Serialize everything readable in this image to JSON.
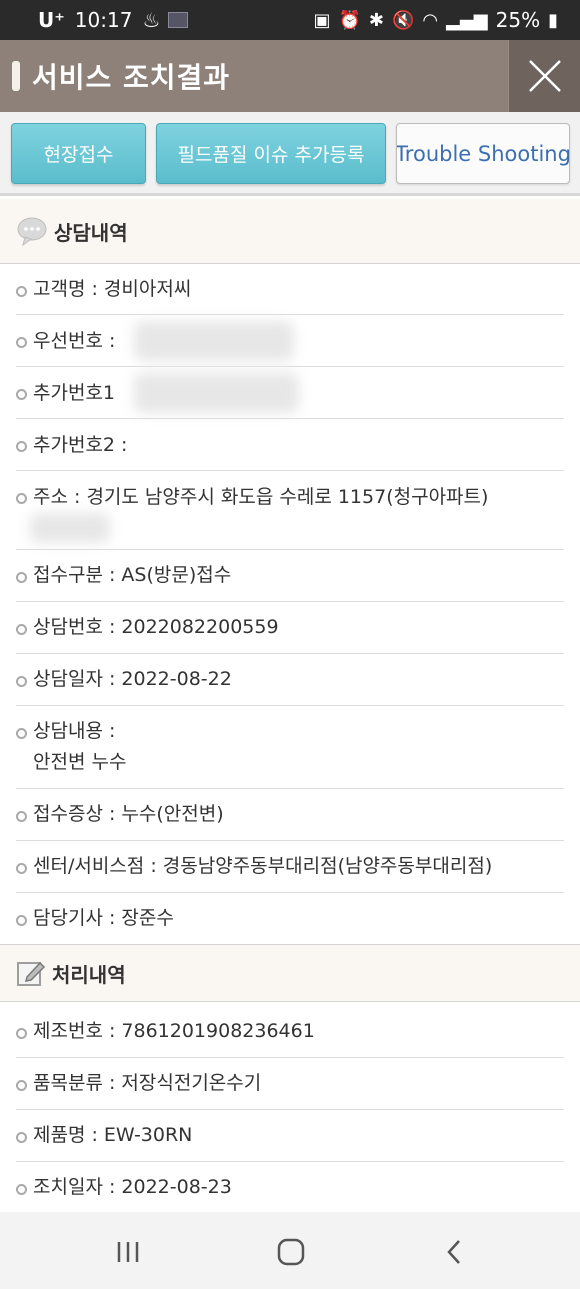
{
  "status_bar": {
    "carrier": "U⁺",
    "time": "10:17",
    "battery": "25%"
  },
  "title_bar": {
    "title": "서비스 조치결과"
  },
  "buttons": {
    "onsite": "현장접수",
    "field_quality": "필드품질 이슈 추가등록",
    "trouble": "Trouble Shooting"
  },
  "consultation": {
    "header": "상담내역",
    "customer": "고객명 : 경비아저씨",
    "phone_label": "우선번호 :",
    "extra1_label": "추가번호1",
    "extra2_label": "추가번호2 :",
    "address": "주소 : 경기도 남양주시 화도읍 수레로 1157(청구아파트)",
    "reception_type": "접수구분 : AS(방문)접수",
    "consult_no": "상담번호 : 2022082200559",
    "consult_date": "상담일자 : 2022-08-22",
    "content_label": "상담내용 :",
    "content_value": "안전변 누수",
    "symptom": "접수증상 : 누수(안전변)",
    "center": "센터/서비스점 : 경동남양주동부대리점(남양주동부대리점)",
    "engineer": "담당기사 : 장준수"
  },
  "processing": {
    "header": "처리내역",
    "serial": "제조번호 : 7861201908236461",
    "category": "품목분류 : 저장식전기온수기",
    "model": "제품명 : EW-30RN",
    "action_date": "조치일자 : 2022-08-23"
  }
}
